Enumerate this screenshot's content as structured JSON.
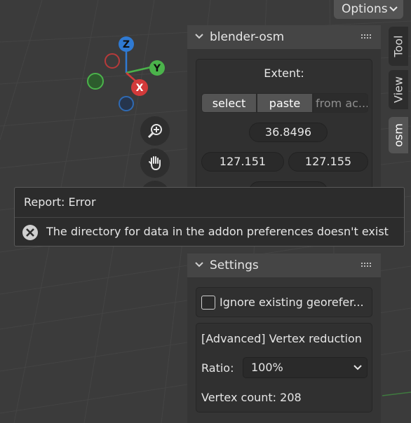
{
  "header": {
    "options_label": "Options"
  },
  "gizmo": {
    "z_label": "Z",
    "y_label": "Y",
    "x_label": "X"
  },
  "side_tabs": [
    {
      "label": "Tool",
      "active": false
    },
    {
      "label": "View",
      "active": false
    },
    {
      "label": "osm",
      "active": true
    }
  ],
  "osm_panel": {
    "title": "blender-osm",
    "extent_label": "Extent:",
    "buttons": {
      "select": "select",
      "paste": "paste",
      "from_active": "from ac..."
    },
    "coords": {
      "top": "36.8496",
      "left": "127.151",
      "right": "127.155"
    }
  },
  "report": {
    "title": "Report: Error",
    "message": "The directory for data in the addon preferences doesn't exist"
  },
  "settings_panel": {
    "title": "Settings",
    "ignore_georef_label": "Ignore existing georefer...",
    "ignore_georef_checked": false,
    "advanced_title": "[Advanced] Vertex reduction",
    "ratio_label": "Ratio:",
    "ratio_value": "100%",
    "vertex_count": "Vertex count: 208"
  },
  "colors": {
    "axis_z": "#2f7ad3",
    "axis_y": "#4bb34b",
    "axis_x": "#d23a3a"
  }
}
